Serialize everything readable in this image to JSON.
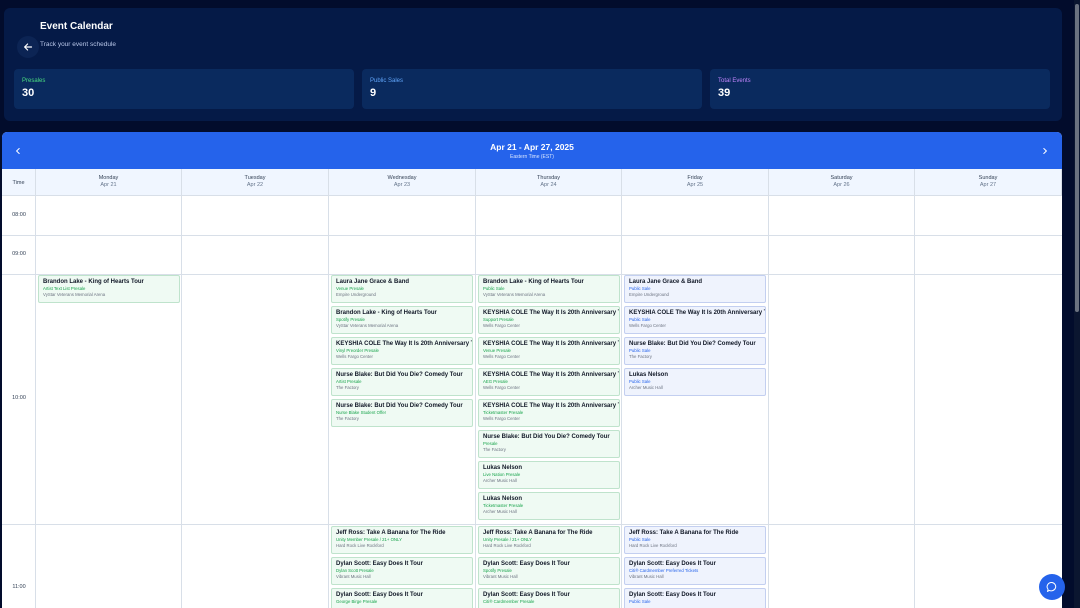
{
  "header": {
    "title": "Event Calendar",
    "subtitle": "Track your event schedule",
    "stats": [
      {
        "label": "Presales",
        "value": "30",
        "color": "#4ade80"
      },
      {
        "label": "Public Sales",
        "value": "9",
        "color": "#60a5fa"
      },
      {
        "label": "Total Events",
        "value": "39",
        "color": "#c084fc"
      }
    ]
  },
  "calendar": {
    "range": "Apr 21 - Apr 27, 2025",
    "timezone": "Eastern Time (EST)",
    "time_header": "Time",
    "days": [
      {
        "name": "Monday",
        "date": "Apr 21"
      },
      {
        "name": "Tuesday",
        "date": "Apr 22"
      },
      {
        "name": "Wednesday",
        "date": "Apr 23"
      },
      {
        "name": "Thursday",
        "date": "Apr 24"
      },
      {
        "name": "Friday",
        "date": "Apr 25"
      },
      {
        "name": "Saturday",
        "date": "Apr 26"
      },
      {
        "name": "Sunday",
        "date": "Apr 27"
      }
    ],
    "times": [
      "08:00",
      "09:00",
      "10:00",
      "11:00"
    ],
    "events": [
      {
        "day": 0,
        "slot": 0,
        "kind": "presale",
        "title": "Brandon Lake - King of Hearts Tour",
        "type": "Artist Text List Presale",
        "venue": "VyStar Veterans Memorial Arena"
      },
      {
        "day": 2,
        "slot": 0,
        "kind": "presale",
        "title": "Laura Jane Grace & Band",
        "type": "Venue Presale",
        "venue": "Empire Underground"
      },
      {
        "day": 2,
        "slot": 1,
        "kind": "presale",
        "title": "Brandon Lake - King of Hearts Tour",
        "type": "Spotify Presale",
        "venue": "VyStar Veterans Memorial Arena"
      },
      {
        "day": 2,
        "slot": 2,
        "kind": "presale",
        "title": "KEYSHIA COLE The Way It Is 20th Anniversary Tour",
        "type": "Vinyl Preorder Presale",
        "venue": "Wells Fargo Center"
      },
      {
        "day": 2,
        "slot": 3,
        "kind": "presale",
        "title": "Nurse Blake: But Did You Die? Comedy Tour",
        "type": "Artist Presale",
        "venue": "The Factory"
      },
      {
        "day": 2,
        "slot": 4,
        "kind": "presale",
        "title": "Nurse Blake: But Did You Die? Comedy Tour",
        "type": "Nurse Blake Student Offer",
        "venue": "The Factory"
      },
      {
        "day": 3,
        "slot": 0,
        "kind": "presale",
        "title": "Brandon Lake - King of Hearts Tour",
        "type": "Public Sale",
        "venue": "VyStar Veterans Memorial Arena"
      },
      {
        "day": 3,
        "slot": 1,
        "kind": "presale",
        "title": "KEYSHIA COLE The Way It Is 20th Anniversary Tour",
        "type": "Support Presale",
        "venue": "Wells Fargo Center"
      },
      {
        "day": 3,
        "slot": 2,
        "kind": "presale",
        "title": "KEYSHIA COLE The Way It Is 20th Anniversary Tour",
        "type": "Venue Presale",
        "venue": "Wells Fargo Center"
      },
      {
        "day": 3,
        "slot": 3,
        "kind": "presale",
        "title": "KEYSHIA COLE The Way It Is 20th Anniversary Tour",
        "type": "AEG Presale",
        "venue": "Wells Fargo Center"
      },
      {
        "day": 3,
        "slot": 4,
        "kind": "presale",
        "title": "KEYSHIA COLE The Way It Is 20th Anniversary Tour",
        "type": "Ticketmaster Presale",
        "venue": "Wells Fargo Center"
      },
      {
        "day": 3,
        "slot": 5,
        "kind": "presale",
        "title": "Nurse Blake: But Did You Die? Comedy Tour",
        "type": "Presale",
        "venue": "The Factory"
      },
      {
        "day": 3,
        "slot": 6,
        "kind": "presale",
        "title": "Lukas Nelson",
        "type": "Live Nation Presale",
        "venue": "Archer Music Hall"
      },
      {
        "day": 3,
        "slot": 7,
        "kind": "presale",
        "title": "Lukas Nelson",
        "type": "Ticketmaster Presale",
        "venue": "Archer Music Hall"
      },
      {
        "day": 4,
        "slot": 0,
        "kind": "public",
        "title": "Laura Jane Grace & Band",
        "type": "Public Sale",
        "venue": "Empire Underground"
      },
      {
        "day": 4,
        "slot": 1,
        "kind": "public",
        "title": "KEYSHIA COLE The Way It Is 20th Anniversary Tour",
        "type": "Public Sale",
        "venue": "Wells Fargo Center"
      },
      {
        "day": 4,
        "slot": 2,
        "kind": "public",
        "title": "Nurse Blake: But Did You Die? Comedy Tour",
        "type": "Public Sale",
        "venue": "The Factory"
      },
      {
        "day": 4,
        "slot": 3,
        "kind": "public",
        "title": "Lukas Nelson",
        "type": "Public Sale",
        "venue": "Archer Music Hall"
      },
      {
        "day": 2,
        "slot": 8,
        "kind": "presale",
        "title": "Jeff Ross: Take A Banana for The Ride",
        "type": "Unity Member Presale / 21+ ONLY",
        "venue": "Hard Rock Live Rockford"
      },
      {
        "day": 2,
        "slot": 9,
        "kind": "presale",
        "title": "Dylan Scott: Easy Does It Tour",
        "type": "Dylan Scott Presale",
        "venue": "Vibrant Music Hall"
      },
      {
        "day": 2,
        "slot": 10,
        "kind": "presale",
        "title": "Dylan Scott: Easy Does It Tour",
        "type": "George Birge Presale",
        "venue": ""
      },
      {
        "day": 3,
        "slot": 8,
        "kind": "presale",
        "title": "Jeff Ross: Take A Banana for The Ride",
        "type": "Unity Presale / 21+ ONLY",
        "venue": "Hard Rock Live Rockford"
      },
      {
        "day": 3,
        "slot": 9,
        "kind": "presale",
        "title": "Dylan Scott: Easy Does It Tour",
        "type": "Spotify Presale",
        "venue": "Vibrant Music Hall"
      },
      {
        "day": 3,
        "slot": 10,
        "kind": "presale",
        "title": "Dylan Scott: Easy Does It Tour",
        "type": "Citi® Cardmember Presale",
        "venue": ""
      },
      {
        "day": 4,
        "slot": 8,
        "kind": "public",
        "title": "Jeff Ross: Take A Banana for The Ride",
        "type": "Public Sale",
        "venue": "Hard Rock Live Rockford"
      },
      {
        "day": 4,
        "slot": 9,
        "kind": "public",
        "title": "Dylan Scott: Easy Does It Tour",
        "type": "Citi® Cardmember Preferred Tickets",
        "venue": "Vibrant Music Hall"
      },
      {
        "day": 4,
        "slot": 10,
        "kind": "public",
        "title": "Dylan Scott: Easy Does It Tour",
        "type": "Public Sale",
        "venue": ""
      }
    ]
  }
}
